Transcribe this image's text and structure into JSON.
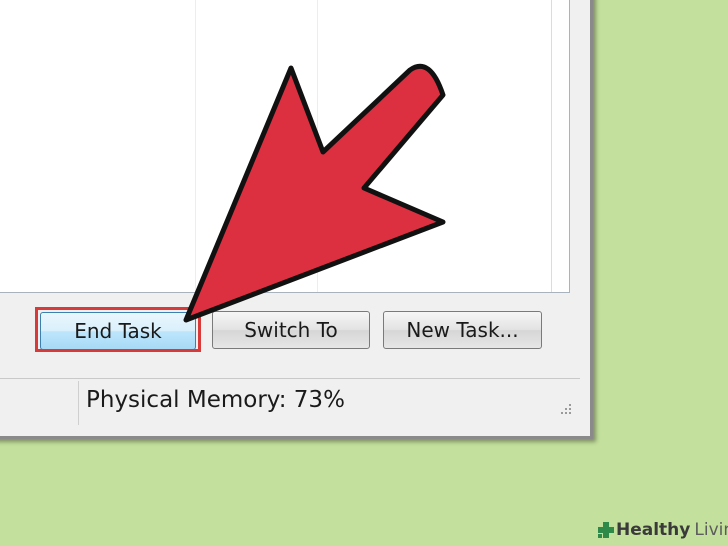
{
  "buttons": {
    "end_task": "End Task",
    "switch_to": "Switch To",
    "new_task": "New Task..."
  },
  "statusbar": {
    "physical_memory": "Physical Memory: 73%"
  },
  "watermark": {
    "healthy": "Healthy",
    "living": "Living"
  },
  "icons": {
    "arrow": "red-arrow-pointer",
    "grip": "resize-grip-icon",
    "logo": "healthy-living-cross-icon"
  },
  "colors": {
    "background": "#c3e09c",
    "arrow_fill": "#dc3040",
    "highlight_frame": "#d83a3a",
    "button_hover": "#bee6fd"
  }
}
